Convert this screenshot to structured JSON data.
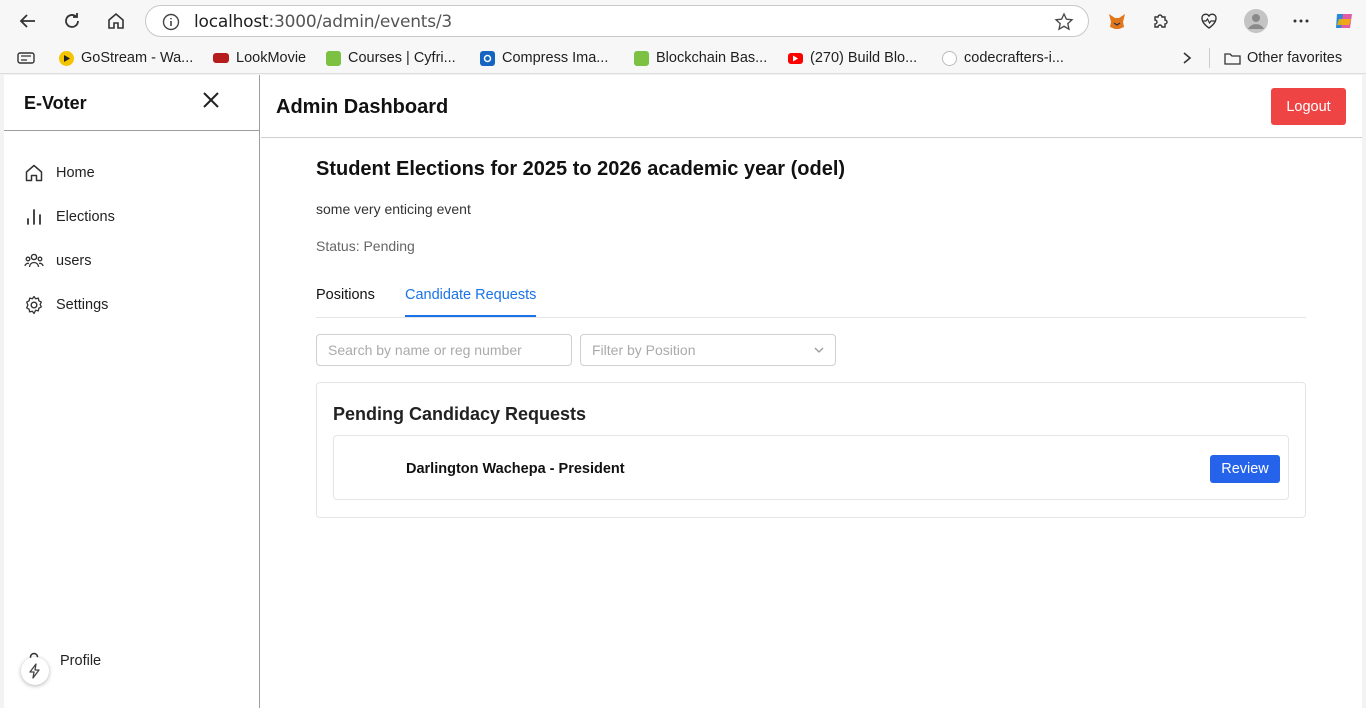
{
  "browser": {
    "url_host": "localhost",
    "url_path": ":3000/admin/events/3",
    "bookmarks": [
      {
        "label": "GoStream - Wa...",
        "icon": "gostream-icon",
        "color": "#f5c400"
      },
      {
        "label": "LookMovie",
        "icon": "lookmovie-icon",
        "color": "#b71c1c"
      },
      {
        "label": "Courses | Cyfri...",
        "icon": "cyfrin-icon",
        "color": "#7cc142"
      },
      {
        "label": "Compress Ima...",
        "icon": "compress-icon",
        "color": "#1565c0"
      },
      {
        "label": "Blockchain Bas...",
        "icon": "blockchain-icon",
        "color": "#7cc142"
      },
      {
        "label": "(270) Build Blo...",
        "icon": "youtube-icon",
        "color": "#ff0000"
      },
      {
        "label": "codecrafters-i...",
        "icon": "github-icon",
        "color": "#333333"
      }
    ],
    "other_favorites": "Other favorites"
  },
  "sidebar": {
    "brand": "E-Voter",
    "items": [
      {
        "label": "Home",
        "icon": "home-icon"
      },
      {
        "label": "Elections",
        "icon": "bar-chart-icon"
      },
      {
        "label": "users",
        "icon": "users-icon"
      },
      {
        "label": "Settings",
        "icon": "gear-icon"
      }
    ],
    "profile": "Profile"
  },
  "header": {
    "title": "Admin Dashboard",
    "logout": "Logout"
  },
  "event": {
    "title": "Student Elections for 2025 to 2026 academic year (odel)",
    "description": "some very enticing event",
    "status": "Status: Pending"
  },
  "tabs": [
    {
      "label": "Positions",
      "active": false
    },
    {
      "label": "Candidate Requests",
      "active": true
    }
  ],
  "filters": {
    "search_placeholder": "Search by name or reg number",
    "position_placeholder": "Filter by Position"
  },
  "requests": {
    "title": "Pending Candidacy Requests",
    "items": [
      {
        "name": "Darlington Wachepa - President",
        "action": "Review"
      }
    ]
  },
  "colors": {
    "accent": "#1a73e8",
    "danger": "#ef4444",
    "primary": "#2563eb"
  }
}
